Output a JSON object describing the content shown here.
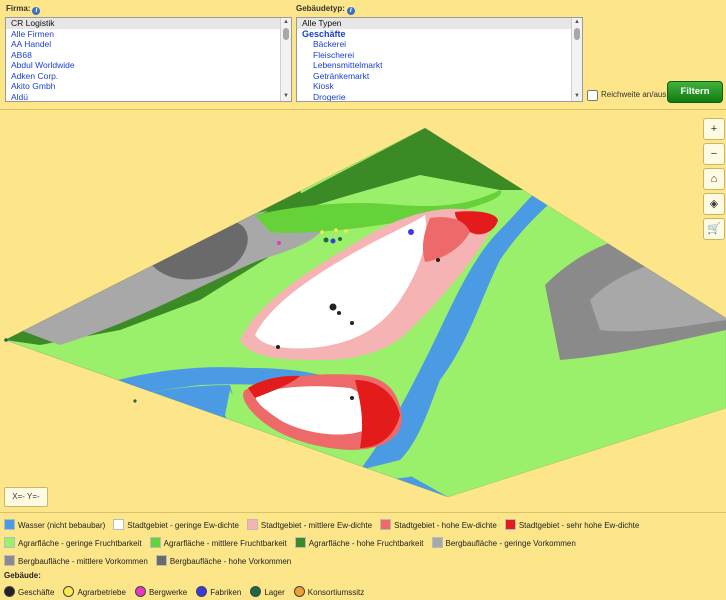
{
  "filters": {
    "firma_label": "Firma:",
    "firma_options": [
      {
        "label": "CR Logistik",
        "selected": true
      },
      {
        "label": "Alle Firmen",
        "selected": false
      },
      {
        "label": "AA Handel",
        "selected": false
      },
      {
        "label": "AB68",
        "selected": false
      },
      {
        "label": "Abdul Worldwide",
        "selected": false
      },
      {
        "label": "Adken Corp.",
        "selected": false
      },
      {
        "label": "Akito Gmbh",
        "selected": false
      },
      {
        "label": "Aldü",
        "selected": false
      }
    ],
    "gebaeudetyp_label": "Gebäudetyp:",
    "gebaeudetyp_options": [
      {
        "label": "Alle Typen",
        "kind": "selected"
      },
      {
        "label": "Geschäfte",
        "kind": "group"
      },
      {
        "label": "Bäckerei",
        "kind": "sub"
      },
      {
        "label": "Fleischerei",
        "kind": "sub"
      },
      {
        "label": "Lebensmittelmarkt",
        "kind": "sub"
      },
      {
        "label": "Getränkemarkt",
        "kind": "sub"
      },
      {
        "label": "Kiosk",
        "kind": "sub"
      },
      {
        "label": "Drogerie",
        "kind": "sub"
      }
    ],
    "reichweite_label": "Reichweite an/aus",
    "filter_button": "Filtern"
  },
  "map": {
    "controls": [
      "+",
      "−",
      "⌂",
      "◈",
      "🛒"
    ],
    "coords": "X=- Y=-"
  },
  "legend": {
    "terrain": [
      {
        "label": "Wasser (nicht bebaubar)",
        "color": "#4a9be3"
      },
      {
        "label": "Stadtgebiet - geringe Ew-dichte",
        "color": "#ffffff"
      },
      {
        "label": "Stadtgebiet - mittlere Ew-dichte",
        "color": "#f5b3b3"
      },
      {
        "label": "Stadtgebiet - hohe Ew-dichte",
        "color": "#ee6a6a"
      },
      {
        "label": "Stadtgebiet - sehr hohe Ew-dichte",
        "color": "#e31b1b"
      },
      {
        "label": "Agrarfläche - geringe Fruchtbarkeit",
        "color": "#9af06a"
      },
      {
        "label": "Agrarfläche - mittlere Fruchtbarkeit",
        "color": "#66d23a"
      },
      {
        "label": "Agrarfläche - hohe Fruchtbarkeit",
        "color": "#3c8a25"
      },
      {
        "label": "Bergbaufläche - geringe Vorkommen",
        "color": "#a8a8a8"
      },
      {
        "label": "Bergbaufläche - mittlere Vorkommen",
        "color": "#8a8a8a"
      },
      {
        "label": "Bergbaufläche - hohe Vorkommen",
        "color": "#6a6a6a"
      }
    ],
    "buildings_title": "Gebäude:",
    "buildings": [
      {
        "label": "Geschäfte",
        "color": "#222222"
      },
      {
        "label": "Agrarbetriebe",
        "color": "#ffe84a"
      },
      {
        "label": "Bergwerke",
        "color": "#e838c2"
      },
      {
        "label": "Fabriken",
        "color": "#3a3ae3"
      },
      {
        "label": "Lager",
        "color": "#1a6a4a"
      },
      {
        "label": "Konsortiumssitz",
        "color": "#f0a030"
      }
    ]
  }
}
